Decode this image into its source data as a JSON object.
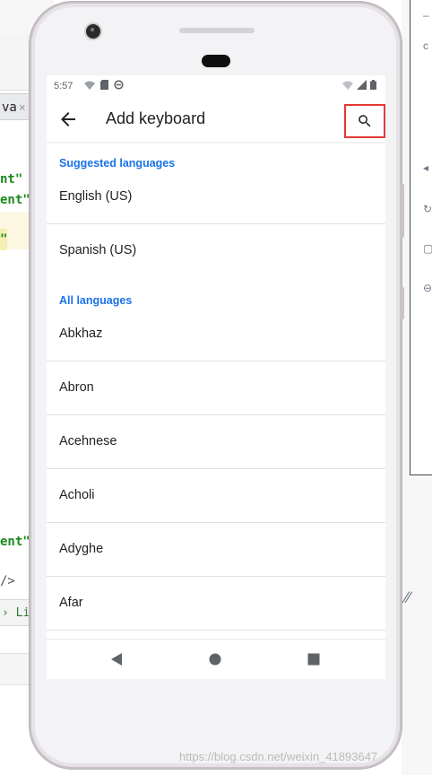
{
  "ide": {
    "tab_label": "va",
    "tab_close": "×",
    "code_lines": [
      "nt\"",
      "ent\"",
      "\"",
      "ent\""
    ],
    "code_slash": "/>",
    "bottom_bar": "› Li"
  },
  "status_bar": {
    "time": "5:57"
  },
  "toolbar": {
    "title": "Add keyboard",
    "back_icon": "arrow-back-icon",
    "search_icon": "search-icon",
    "search_highlight_color": "#e53935"
  },
  "sections": {
    "suggested": {
      "header": "Suggested languages",
      "items": [
        "English (US)",
        "Spanish (US)"
      ]
    },
    "all": {
      "header": "All languages",
      "items": [
        "Abkhaz",
        "Abron",
        "Acehnese",
        "Acholi",
        "Adyghe",
        "Afar"
      ]
    }
  },
  "nav_bar": {
    "back_icon": "nav-back-icon",
    "home_icon": "nav-home-icon",
    "recents_icon": "nav-recents-icon"
  },
  "watermark": "https://blog.csdn.net/weixin_41893647",
  "colors": {
    "accent": "#1a73e8",
    "text": "#202124"
  }
}
